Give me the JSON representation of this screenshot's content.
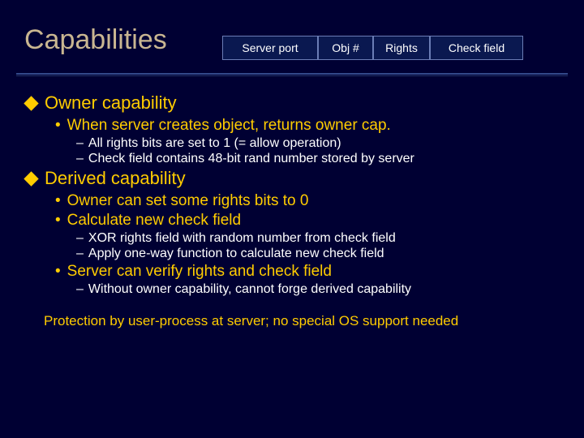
{
  "title": "Capabilities",
  "table": {
    "server": "Server port",
    "obj": "Obj #",
    "rights": "Rights",
    "check": "Check field"
  },
  "s1": {
    "title": "Owner capability",
    "b1": "When server creates object, returns owner cap.",
    "d1": "All rights bits are set to 1  (= allow operation)",
    "d2": "Check field contains 48-bit rand number stored by server"
  },
  "s2": {
    "title": "Derived capability",
    "b1": "Owner can set some rights bits to 0",
    "b2": "Calculate new check field",
    "d1": "XOR rights field with random number from check field",
    "d2": "Apply one-way function to calculate new check field",
    "b3": "Server can verify rights and check field",
    "d3": "Without owner capability, cannot forge derived capability"
  },
  "footer": "Protection by user-process at server; no special OS support needed"
}
